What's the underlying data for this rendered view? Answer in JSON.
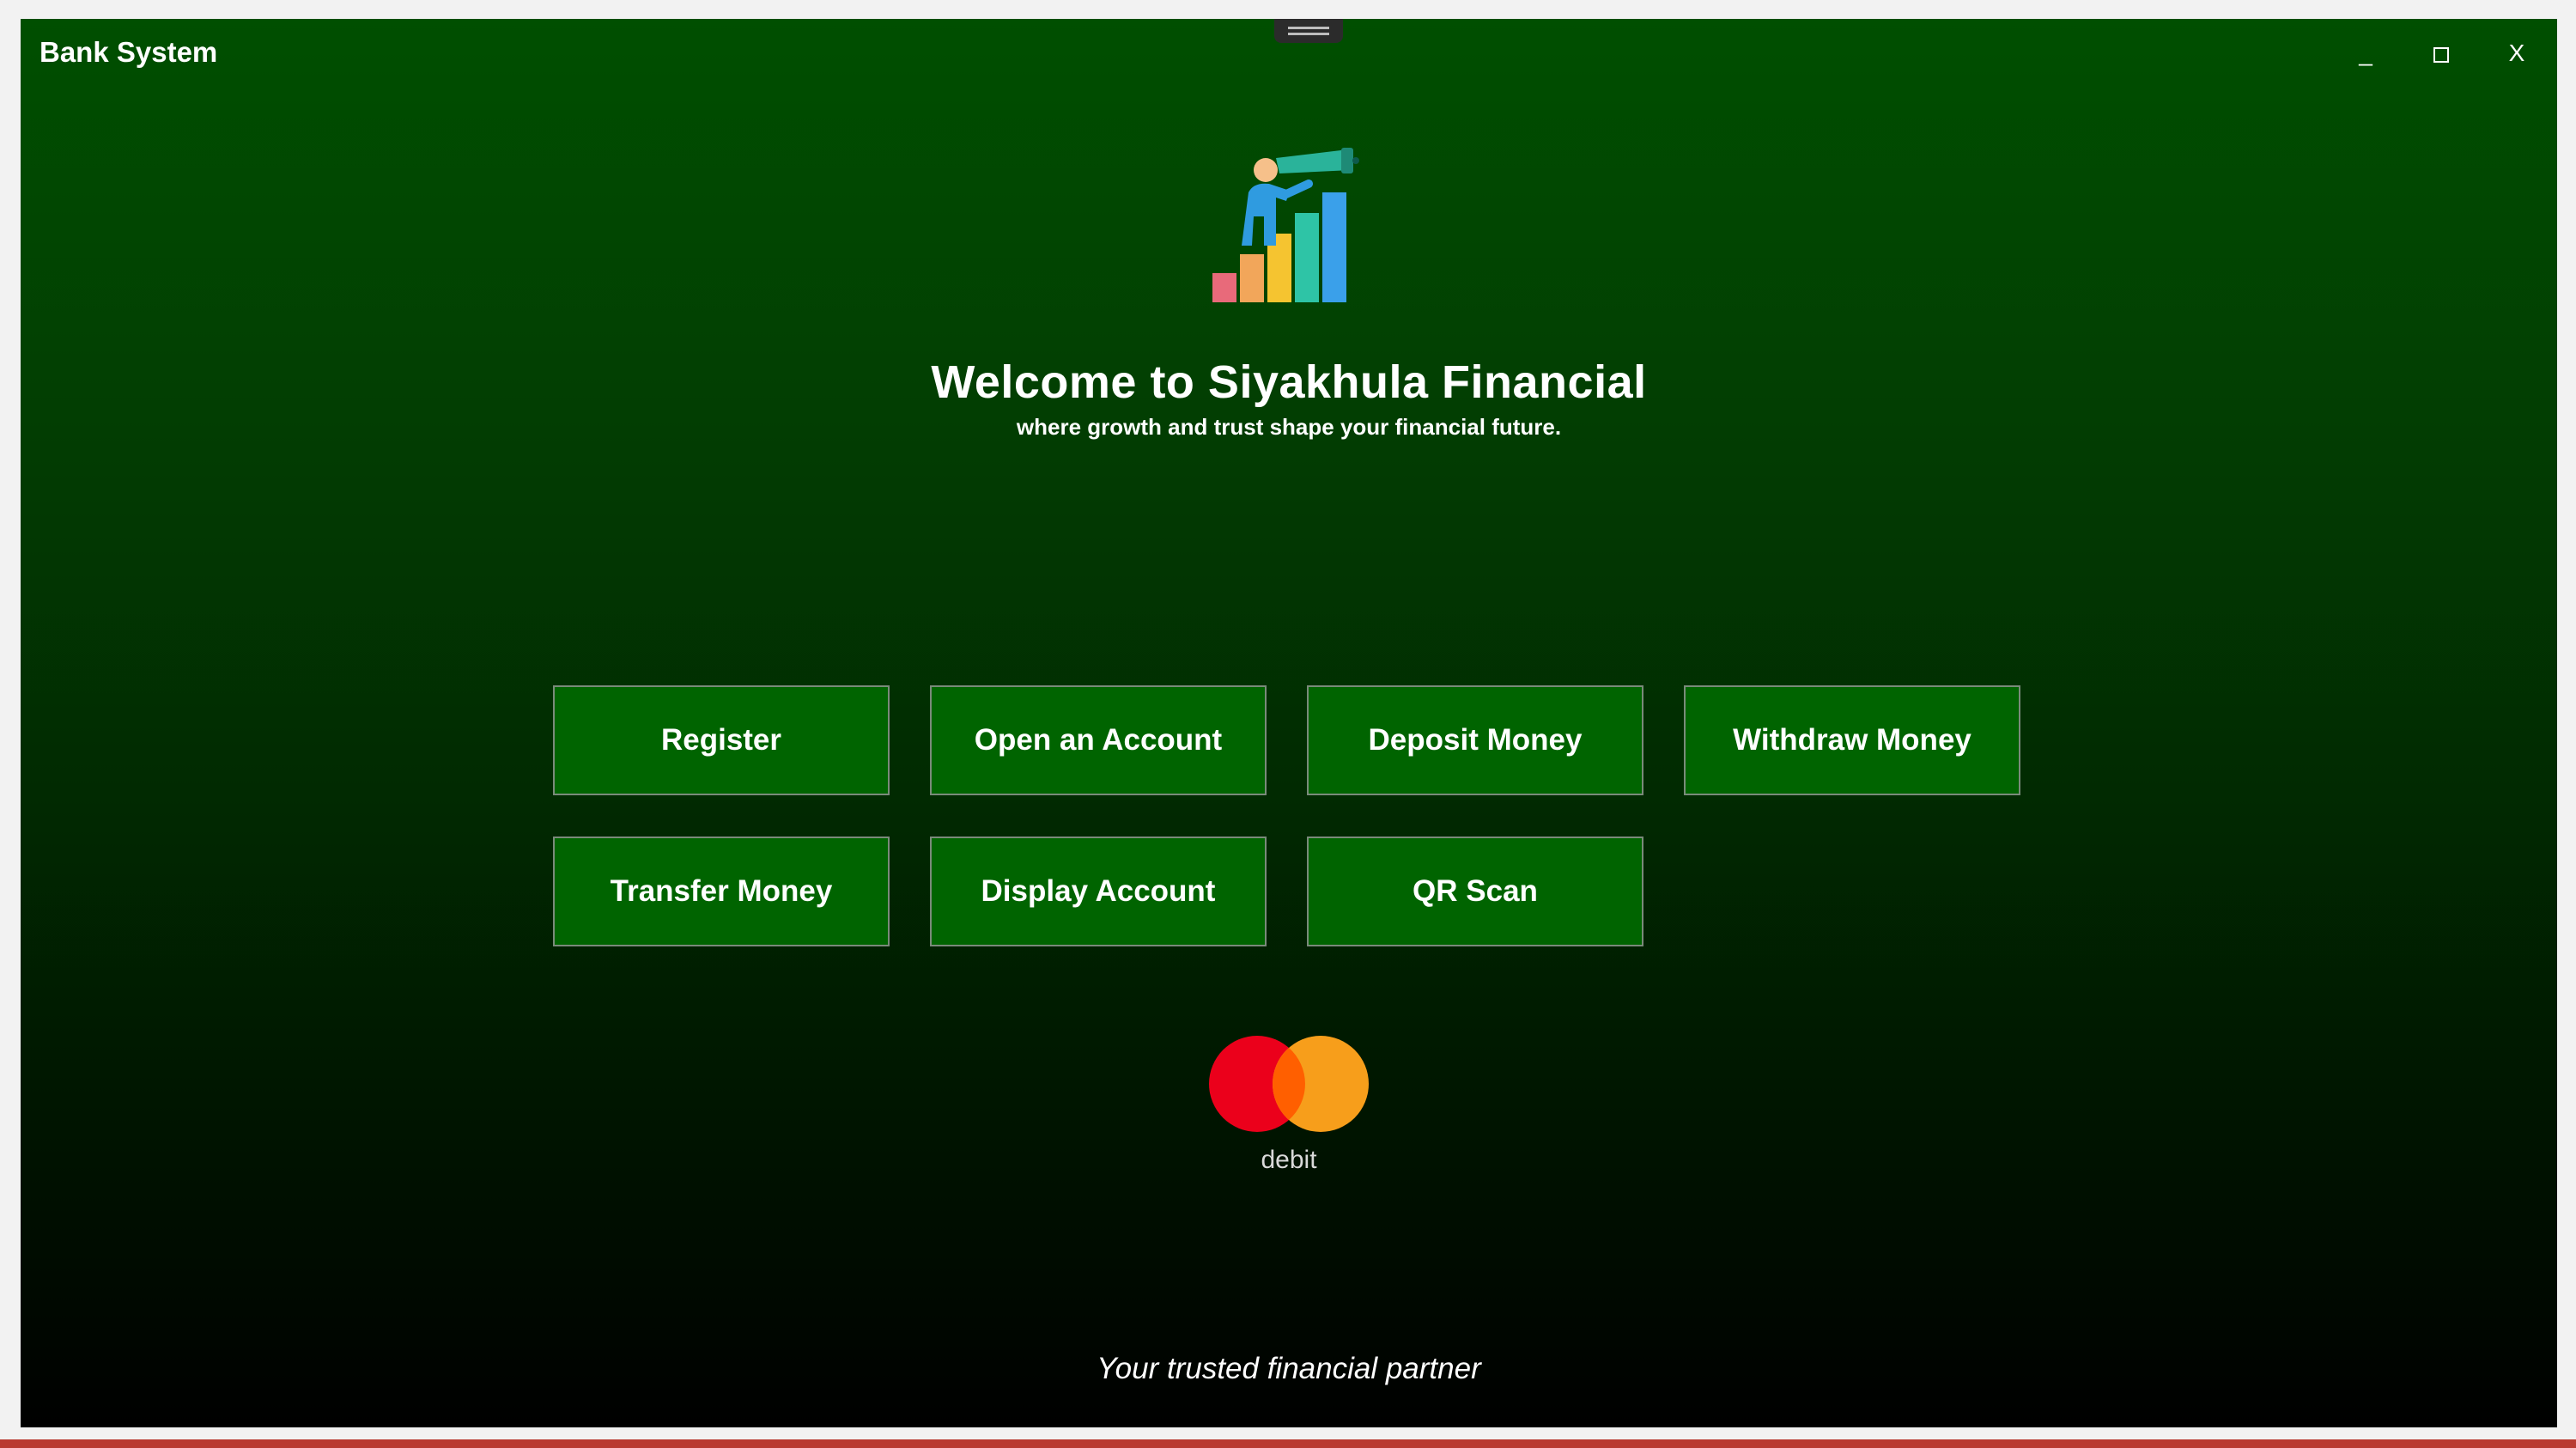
{
  "window": {
    "title": "Bank System",
    "controls": {
      "minimize": "_",
      "maximize": "□",
      "close": "X"
    }
  },
  "hero": {
    "icon": "telescope-growth-chart-icon",
    "headline": "Welcome to Siyakhula Financial",
    "subline": "where growth and trust shape your financial future."
  },
  "buttons": {
    "register": "Register",
    "open_account": "Open an Account",
    "deposit": "Deposit Money",
    "withdraw": "Withdraw Money",
    "transfer": "Transfer Money",
    "display_account": "Display Account",
    "qr_scan": "QR Scan"
  },
  "card_logo": {
    "icon": "mastercard-logo",
    "label": "debit"
  },
  "footer": {
    "tagline": "Your trusted financial partner"
  },
  "colors": {
    "gradient_top": "#004f00",
    "gradient_bottom": "#000000",
    "button_bg": "#006400",
    "mc_red": "#eb001b",
    "mc_orange": "#f79e1b"
  }
}
